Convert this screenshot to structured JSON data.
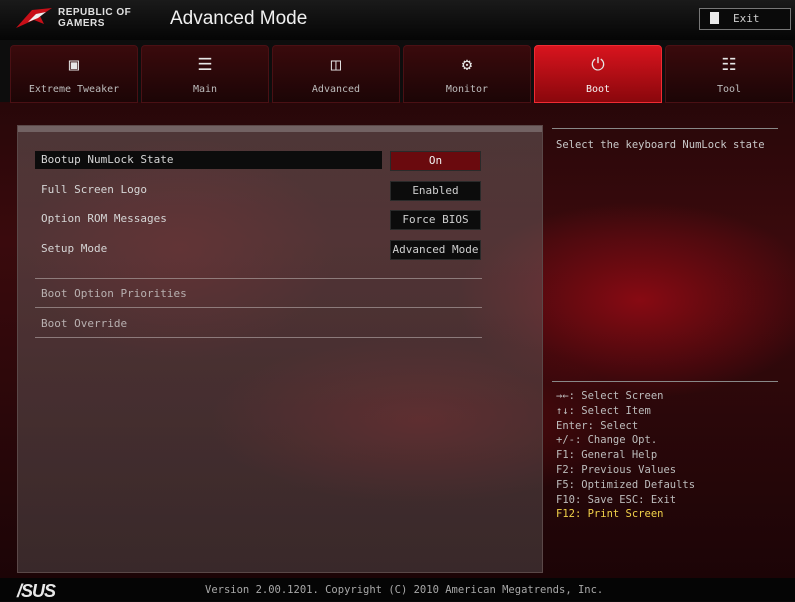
{
  "header": {
    "brand_line1": "REPUBLIC OF",
    "brand_line2": "GAMERS",
    "mode_title": "Advanced Mode",
    "exit_label": "Exit"
  },
  "tabs": [
    {
      "label": "Extreme Tweaker",
      "icon": "chip-icon"
    },
    {
      "label": "Main",
      "icon": "list-icon"
    },
    {
      "label": "Advanced",
      "icon": "advanced-icon"
    },
    {
      "label": "Monitor",
      "icon": "monitor-icon"
    },
    {
      "label": "Boot",
      "icon": "power-icon",
      "active": true
    },
    {
      "label": "Tool",
      "icon": "tool-icon"
    }
  ],
  "settings": [
    {
      "name": "Bootup NumLock State",
      "value": "On",
      "selected": true
    },
    {
      "name": "Full Screen Logo",
      "value": "Enabled"
    },
    {
      "name": "Option ROM Messages",
      "value": "Force BIOS"
    },
    {
      "name": "Setup Mode",
      "value": "Advanced Mode"
    }
  ],
  "submenus": [
    "Boot Option Priorities",
    "Boot Override"
  ],
  "help": {
    "description": "Select the keyboard NumLock state",
    "keys": [
      "→←: Select Screen",
      "↑↓: Select Item",
      "Enter: Select",
      "+/-: Change Opt.",
      "F1: General Help",
      "F2: Previous Values",
      "F5: Optimized Defaults",
      "F10: Save  ESC: Exit",
      "F12: Print Screen"
    ]
  },
  "footer": {
    "brand": "/SUS",
    "version": "Version 2.00.1201. Copyright (C) 2010 American Megatrends, Inc."
  },
  "colors": {
    "accent": "#d8141e",
    "highlight_key": "#f2d24a"
  }
}
